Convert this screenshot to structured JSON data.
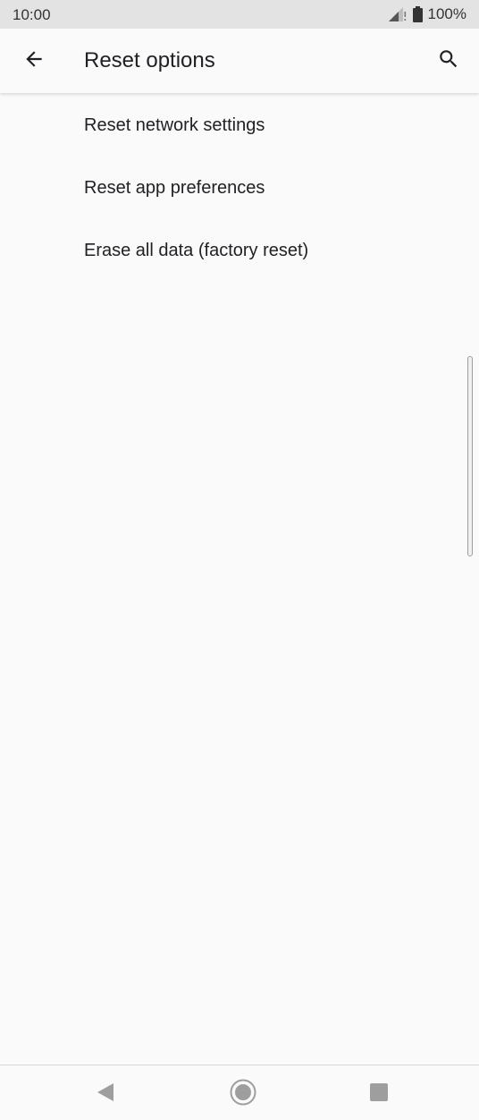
{
  "status_bar": {
    "time": "10:00",
    "battery": "100%",
    "icons": [
      "signal-icon",
      "battery-icon"
    ]
  },
  "app_bar": {
    "title": "Reset options",
    "icons": [
      "back-arrow-icon",
      "search-icon"
    ]
  },
  "list": {
    "items": [
      {
        "label": "Reset network settings"
      },
      {
        "label": "Reset app preferences"
      },
      {
        "label": "Erase all data (factory reset)"
      }
    ]
  },
  "nav_bar": {
    "icons": [
      "nav-back-icon",
      "nav-home-icon",
      "nav-recents-icon"
    ]
  },
  "colors": {
    "status_bar_bg": "#e3e3e3",
    "background": "#fafafa",
    "text_primary": "#202124",
    "nav_icon": "#9e9e9e"
  }
}
